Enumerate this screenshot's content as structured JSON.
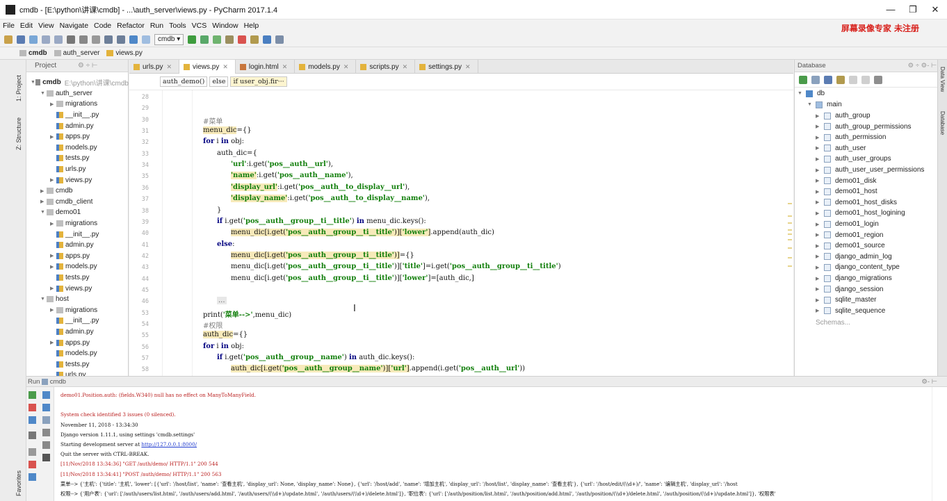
{
  "window": {
    "title": "cmdb - [E:\\python\\讲课\\cmdb] - ...\\auth_server\\views.py - PyCharm 2017.1.4",
    "minimize": "—",
    "maximize": "❐",
    "close": "✕"
  },
  "menu": [
    "File",
    "Edit",
    "View",
    "Navigate",
    "Code",
    "Refactor",
    "Run",
    "Tools",
    "VCS",
    "Window",
    "Help"
  ],
  "watermark": "屏幕录像专家 未注册",
  "toolbar": {
    "run_config": "cmdb ▾"
  },
  "breadcrumbs": [
    "cmdb",
    "auth_server",
    "views.py"
  ],
  "left_strip": {
    "project": "1: Project",
    "structure": "Z: Structure",
    "favorites": "Favorites"
  },
  "project": {
    "header": "Project",
    "items": [
      {
        "label": "cmdb",
        "extra": "E:\\python\\讲课\\cmdb",
        "type": "root",
        "depth": 0,
        "open": true
      },
      {
        "label": "auth_server",
        "type": "dir",
        "depth": 1,
        "open": true
      },
      {
        "label": "migrations",
        "type": "dir",
        "depth": 2,
        "open": false
      },
      {
        "label": "__init__.py",
        "type": "py",
        "depth": 2
      },
      {
        "label": "admin.py",
        "type": "py",
        "depth": 2
      },
      {
        "label": "apps.py",
        "type": "py",
        "depth": 2,
        "open": false
      },
      {
        "label": "models.py",
        "type": "py",
        "depth": 2
      },
      {
        "label": "tests.py",
        "type": "py",
        "depth": 2
      },
      {
        "label": "urls.py",
        "type": "py",
        "depth": 2
      },
      {
        "label": "views.py",
        "type": "py",
        "depth": 2,
        "open": false
      },
      {
        "label": "cmdb",
        "type": "dir",
        "depth": 1,
        "open": false
      },
      {
        "label": "cmdb_client",
        "type": "dir",
        "depth": 1,
        "open": false
      },
      {
        "label": "demo01",
        "type": "dir",
        "depth": 1,
        "open": true
      },
      {
        "label": "migrations",
        "type": "dir",
        "depth": 2,
        "open": false
      },
      {
        "label": "__init__.py",
        "type": "py",
        "depth": 2
      },
      {
        "label": "admin.py",
        "type": "py",
        "depth": 2
      },
      {
        "label": "apps.py",
        "type": "py",
        "depth": 2,
        "open": false
      },
      {
        "label": "models.py",
        "type": "py",
        "depth": 2,
        "open": false
      },
      {
        "label": "tests.py",
        "type": "py",
        "depth": 2
      },
      {
        "label": "views.py",
        "type": "py",
        "depth": 2,
        "open": false
      },
      {
        "label": "host",
        "type": "dir",
        "depth": 1,
        "open": true
      },
      {
        "label": "migrations",
        "type": "dir",
        "depth": 2,
        "open": false
      },
      {
        "label": "__init__.py",
        "type": "py",
        "depth": 2
      },
      {
        "label": "admin.py",
        "type": "py",
        "depth": 2
      },
      {
        "label": "apps.py",
        "type": "py",
        "depth": 2,
        "open": false
      },
      {
        "label": "models.py",
        "type": "py",
        "depth": 2
      },
      {
        "label": "tests.py",
        "type": "py",
        "depth": 2
      },
      {
        "label": "urls.py",
        "type": "py",
        "depth": 2
      }
    ]
  },
  "tabs": [
    {
      "label": "urls.py",
      "active": false
    },
    {
      "label": "views.py",
      "active": true
    },
    {
      "label": "login.html",
      "active": false
    },
    {
      "label": "models.py",
      "active": false
    },
    {
      "label": "scripts.py",
      "active": false
    },
    {
      "label": "settings.py",
      "active": false
    }
  ],
  "code_breadcrumb": [
    "auth_demo()",
    "else",
    "if user_obj.fir···"
  ],
  "code_lines": [
    {
      "n": "28",
      "parts": []
    },
    {
      "n": "29",
      "parts": []
    },
    {
      "n": "30",
      "indent": 0,
      "parts": [
        [
          "cm",
          "#菜单"
        ]
      ]
    },
    {
      "n": "31",
      "indent": 0,
      "parts": [
        [
          "hl",
          "menu_dic"
        ],
        [
          "",
          "={}"
        ]
      ]
    },
    {
      "n": "32",
      "indent": 0,
      "parts": [
        [
          "kw",
          "for"
        ],
        [
          "",
          " i "
        ],
        [
          "kw",
          "in"
        ],
        [
          "",
          " obj:"
        ]
      ]
    },
    {
      "n": "33",
      "indent": 1,
      "parts": [
        [
          "",
          "auth_dic={"
        ]
      ]
    },
    {
      "n": "34",
      "indent": 2,
      "parts": [
        [
          "st",
          "'url'"
        ],
        [
          "",
          ":i.get("
        ],
        [
          "st",
          "'pos__auth__url'"
        ],
        [
          "",
          "),"
        ]
      ]
    },
    {
      "n": "35",
      "indent": 2,
      "parts": [
        [
          "st hl",
          "'name'"
        ],
        [
          "",
          ":i.get("
        ],
        [
          "st",
          "'pos__auth__name'"
        ],
        [
          "",
          "),"
        ]
      ]
    },
    {
      "n": "36",
      "indent": 2,
      "parts": [
        [
          "st hl",
          "'display_url'"
        ],
        [
          "",
          ":i.get("
        ],
        [
          "st",
          "'pos__auth__to_display__url'"
        ],
        [
          "",
          "),"
        ]
      ]
    },
    {
      "n": "37",
      "indent": 2,
      "parts": [
        [
          "st hl",
          "'display_name'"
        ],
        [
          "",
          ":i.get("
        ],
        [
          "st",
          "'pos__auth__to_display__name'"
        ],
        [
          "",
          "),"
        ]
      ]
    },
    {
      "n": "38",
      "indent": 1,
      "parts": [
        [
          "",
          "}"
        ]
      ]
    },
    {
      "n": "39",
      "indent": 1,
      "parts": [
        [
          "kw",
          "if"
        ],
        [
          "",
          " i.get("
        ],
        [
          "st",
          "'pos__auth__group__ti__title'"
        ],
        [
          ") "
        ],
        [
          "kw",
          "in"
        ],
        [
          "",
          " menu_dic.keys():"
        ]
      ]
    },
    {
      "n": "40",
      "indent": 2,
      "parts": [
        [
          "hl",
          "menu_dic[i.get("
        ],
        [
          "st hl",
          "'pos__auth__group__ti__title'"
        ],
        [
          "hl",
          ")]["
        ],
        [
          "st hl",
          "'lower'"
        ],
        [
          "hl",
          "]"
        ],
        [
          "",
          ".append(auth_dic)"
        ]
      ]
    },
    {
      "n": "41",
      "indent": 1,
      "parts": [
        [
          "kw",
          "else"
        ],
        [
          "",
          ":"
        ]
      ]
    },
    {
      "n": "42",
      "indent": 2,
      "parts": [
        [
          "hl",
          "menu_dic[i.get("
        ],
        [
          "st hl",
          "'pos__auth__group__ti__title'"
        ],
        [
          "hl",
          ")]"
        ],
        [
          "",
          "={}"
        ]
      ]
    },
    {
      "n": "43",
      "indent": 2,
      "parts": [
        [
          "",
          "menu_dic[i.get("
        ],
        [
          "st",
          "'pos__auth__group__ti__title'"
        ],
        [
          "",
          ")]["
        ],
        [
          "st",
          "'title'"
        ],
        [
          "",
          "]=i.get("
        ],
        [
          "st",
          "'pos__auth__group__ti__title'"
        ],
        [
          "",
          ")"
        ]
      ]
    },
    {
      "n": "44",
      "indent": 2,
      "parts": [
        [
          "",
          "menu_dic[i.get("
        ],
        [
          "st",
          "'pos__auth__group__ti__title'"
        ],
        [
          "",
          ")]["
        ],
        [
          "st",
          "'lower'"
        ],
        [
          "",
          "]=[auth_dic,]"
        ]
      ]
    },
    {
      "n": "45",
      "parts": []
    },
    {
      "n": "46",
      "indent": 1,
      "parts": [
        [
          "ell",
          "..."
        ]
      ]
    },
    {
      "n": "53",
      "indent": 0,
      "parts": [
        [
          "",
          "print("
        ],
        [
          "st",
          "'菜单-->'"
        ],
        [
          "",
          ",menu_dic)"
        ]
      ]
    },
    {
      "n": "54",
      "indent": 0,
      "parts": [
        [
          "cm",
          "#权限"
        ]
      ]
    },
    {
      "n": "55",
      "indent": 0,
      "parts": [
        [
          "hl",
          "auth_dic"
        ],
        [
          "",
          "={}"
        ]
      ]
    },
    {
      "n": "56",
      "indent": 0,
      "parts": [
        [
          "kw",
          "for"
        ],
        [
          "",
          " i "
        ],
        [
          "kw",
          "in"
        ],
        [
          "",
          " obj:"
        ]
      ]
    },
    {
      "n": "57",
      "indent": 1,
      "parts": [
        [
          "kw",
          "if"
        ],
        [
          "",
          " i.get("
        ],
        [
          "st",
          "'pos__auth__group__name'"
        ],
        [
          "",
          ") "
        ],
        [
          "kw",
          "in"
        ],
        [
          "",
          " auth_dic.keys():"
        ]
      ]
    },
    {
      "n": "58",
      "indent": 2,
      "parts": [
        [
          "hl",
          "auth_dic[i.get("
        ],
        [
          "st hl",
          "'pos__auth__group__name'"
        ],
        [
          "hl",
          ")]["
        ],
        [
          "st hl",
          "'url'"
        ],
        [
          "hl",
          "]"
        ],
        [
          "",
          ".append(i.get("
        ],
        [
          "st",
          "'pos__auth__url'"
        ],
        [
          "",
          "))"
        ]
      ]
    }
  ],
  "database": {
    "header": "Database",
    "db": "db",
    "schema": "main",
    "tables": [
      "auth_group",
      "auth_group_permissions",
      "auth_permission",
      "auth_user",
      "auth_user_groups",
      "auth_user_user_permissions",
      "demo01_disk",
      "demo01_host",
      "demo01_host_disks",
      "demo01_host_logining",
      "demo01_login",
      "demo01_region",
      "demo01_source",
      "django_admin_log",
      "django_content_type",
      "django_migrations",
      "django_session",
      "sqlite_master",
      "sqlite_sequence"
    ],
    "more": "Schemas..."
  },
  "right_strip": {
    "dataview": "Data View",
    "database": "Database"
  },
  "run": {
    "header": "Run",
    "config": "cmdb"
  },
  "console": [
    {
      "t": "demo01.Position.auth: (fields.W340) null has no effect on ManyToManyField.",
      "c": "red"
    },
    {
      "t": "",
      "c": ""
    },
    {
      "t": "System check identified 3 issues (0 silenced).",
      "c": "red"
    },
    {
      "t": "November 11, 2018 - 13:34:30",
      "c": ""
    },
    {
      "t": "Django version 1.11.1, using settings 'cmdb.settings'",
      "c": ""
    },
    {
      "t": "Starting development server at ",
      "link": "http://127.0.0.1:8000/",
      "c": ""
    },
    {
      "t": "Quit the server with CTRL-BREAK.",
      "c": ""
    },
    {
      "t": "[11/Nov/2018 13:34:36] \"GET /auth/demo/ HTTP/1.1\" 200 544",
      "c": "red"
    },
    {
      "t": "[11/Nov/2018 13:34:41] \"POST /auth/demo/ HTTP/1.1\" 200 563",
      "c": "red"
    },
    {
      "t": "菜单--> {'主机': {'title': '主机', 'lower': [{'url': '/host/list', 'name': '查看主机', 'display_url': None, 'display_name': None}, {'url': '/host/add', 'name': '增加主机', 'display_url': '/host/list', 'display_name': '查看主机'}, {'url': '/host/edit/(\\\\d+)/', 'name': '编辑主机', 'display_url': '/host",
      "c": ""
    },
    {
      "t": "权限--> {'用户表': {'url': ['/auth/users/list.html', '/auth/users/add.html', '/auth/users/(\\\\d+)/update.html', '/auth/users/(\\\\d+)/delete.html']}, '职位表': {'url': ['/auth/position/list.html', '/auth/position/add.html', '/auth/position/(\\\\d+)/delete.html', '/auth/position/(\\\\d+)/update.html']}, '权限表'",
      "c": ""
    }
  ]
}
